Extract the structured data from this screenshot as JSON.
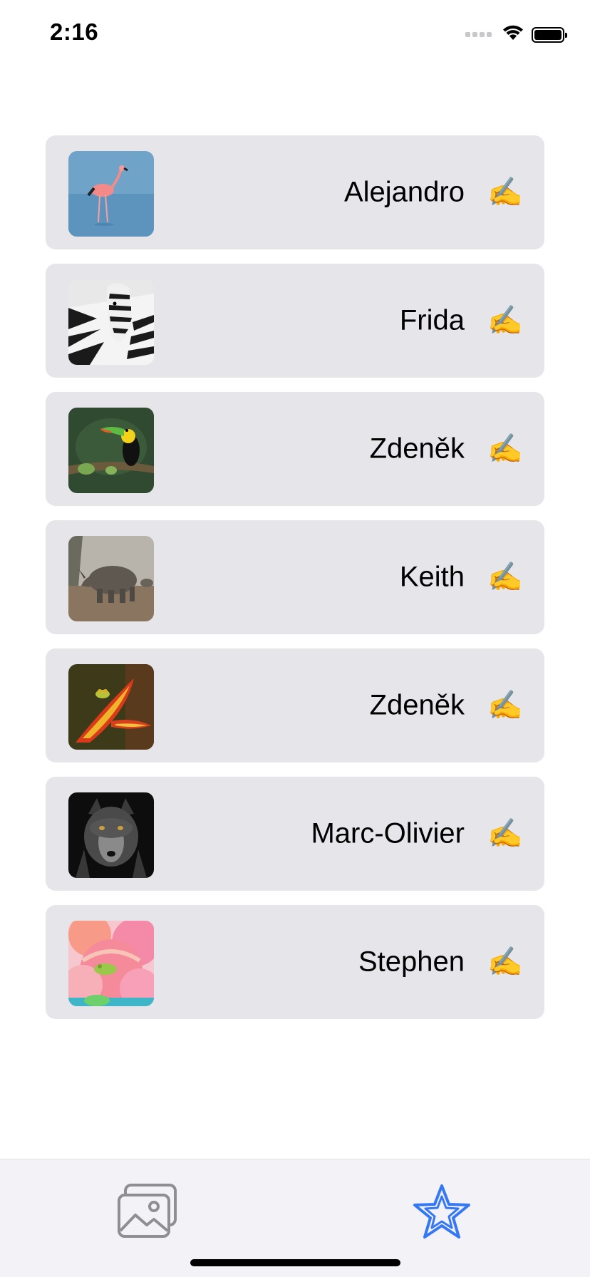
{
  "status_bar": {
    "time": "2:16",
    "icons": [
      "signal-dots-icon",
      "wifi-icon",
      "battery-icon"
    ]
  },
  "list": {
    "items": [
      {
        "name": "Alejandro",
        "image": "flamingo",
        "action_icon": "✍️"
      },
      {
        "name": "Frida",
        "image": "zebra",
        "action_icon": "✍️"
      },
      {
        "name": "Zdeněk",
        "image": "toucan",
        "action_icon": "✍️"
      },
      {
        "name": "Keith",
        "image": "rhino",
        "action_icon": "✍️"
      },
      {
        "name": "Zdeněk",
        "image": "frog-on-flower",
        "action_icon": "✍️"
      },
      {
        "name": "Marc-Olivier",
        "image": "wolf",
        "action_icon": "✍️"
      },
      {
        "name": "Stephen",
        "image": "frog-on-rose",
        "action_icon": "✍️"
      }
    ]
  },
  "tab_bar": {
    "tabs": [
      {
        "icon": "photos-icon",
        "selected": false
      },
      {
        "icon": "star-icon",
        "selected": true
      }
    ],
    "colors": {
      "selected": "#3478f6",
      "unselected": "#8e8e93",
      "background": "#f2f2f7"
    }
  },
  "colors": {
    "card_background": "#e5e5ea",
    "text": "#000000"
  }
}
